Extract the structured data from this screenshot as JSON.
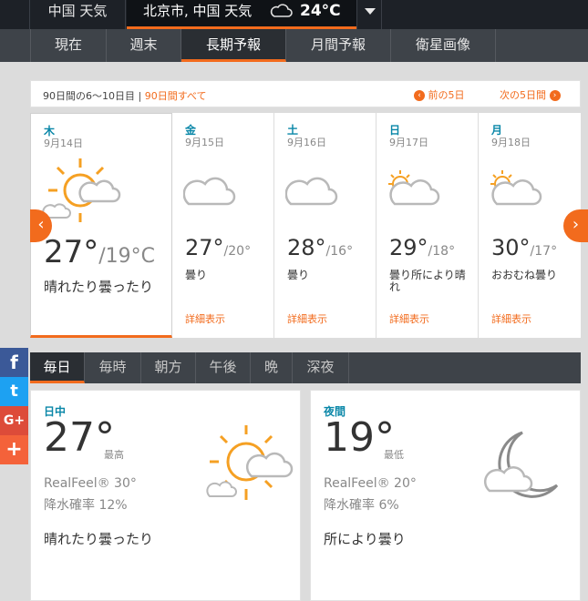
{
  "header": {
    "location_label": "中国 天気",
    "city_label": "北京市, 中国 天気",
    "current_temp": "24°C"
  },
  "nav": {
    "tabs": [
      "現在",
      "週末",
      "長期予報",
      "月間予報",
      "衛星画像"
    ],
    "active_index": 2
  },
  "panel": {
    "range_text": "90日間の6～10日目 | ",
    "all_days_link": "90日間すべて",
    "prev_label": "前の5日",
    "next_label": "次の5日間",
    "prev_arrow": "‹",
    "next_arrow": "›"
  },
  "days": [
    {
      "name": "木",
      "date": "9月14日",
      "hi": "27°",
      "lo": "/19°C",
      "phrase": "晴れたり曇ったり",
      "detail": ""
    },
    {
      "name": "金",
      "date": "9月15日",
      "hi": "27°",
      "lo": "/20°",
      "phrase": "曇り",
      "detail": "詳細表示"
    },
    {
      "name": "土",
      "date": "9月16日",
      "hi": "28°",
      "lo": "/16°",
      "phrase": "曇り",
      "detail": "詳細表示"
    },
    {
      "name": "日",
      "date": "9月17日",
      "hi": "29°",
      "lo": "/18°",
      "phrase": "曇り所により晴れ",
      "detail": "詳細表示"
    },
    {
      "name": "月",
      "date": "9月18日",
      "hi": "30°",
      "lo": "/17°",
      "phrase": "おおむね曇り",
      "detail": "詳細表示"
    }
  ],
  "time_tabs": {
    "tabs": [
      "毎日",
      "毎時",
      "朝方",
      "午後",
      "晩",
      "深夜"
    ],
    "active_index": 0
  },
  "social": {
    "facebook": "f",
    "twitter": "t",
    "google": "G+",
    "more": "+"
  },
  "day_card": {
    "label": "日中",
    "temp": "27°",
    "tag": "最高",
    "realfeel": "RealFeel® 30°",
    "precip": "降水確率 12%",
    "desc": "晴れたり曇ったり"
  },
  "night_card": {
    "label": "夜間",
    "temp": "19°",
    "tag": "最低",
    "realfeel": "RealFeel® 20°",
    "precip": "降水確率 6%",
    "desc": "所により曇り"
  },
  "colors": {
    "accent": "#f26b1d",
    "day_label": "#0a87a8",
    "sun": "#f5a023",
    "cloud": "#b9b9b9"
  }
}
